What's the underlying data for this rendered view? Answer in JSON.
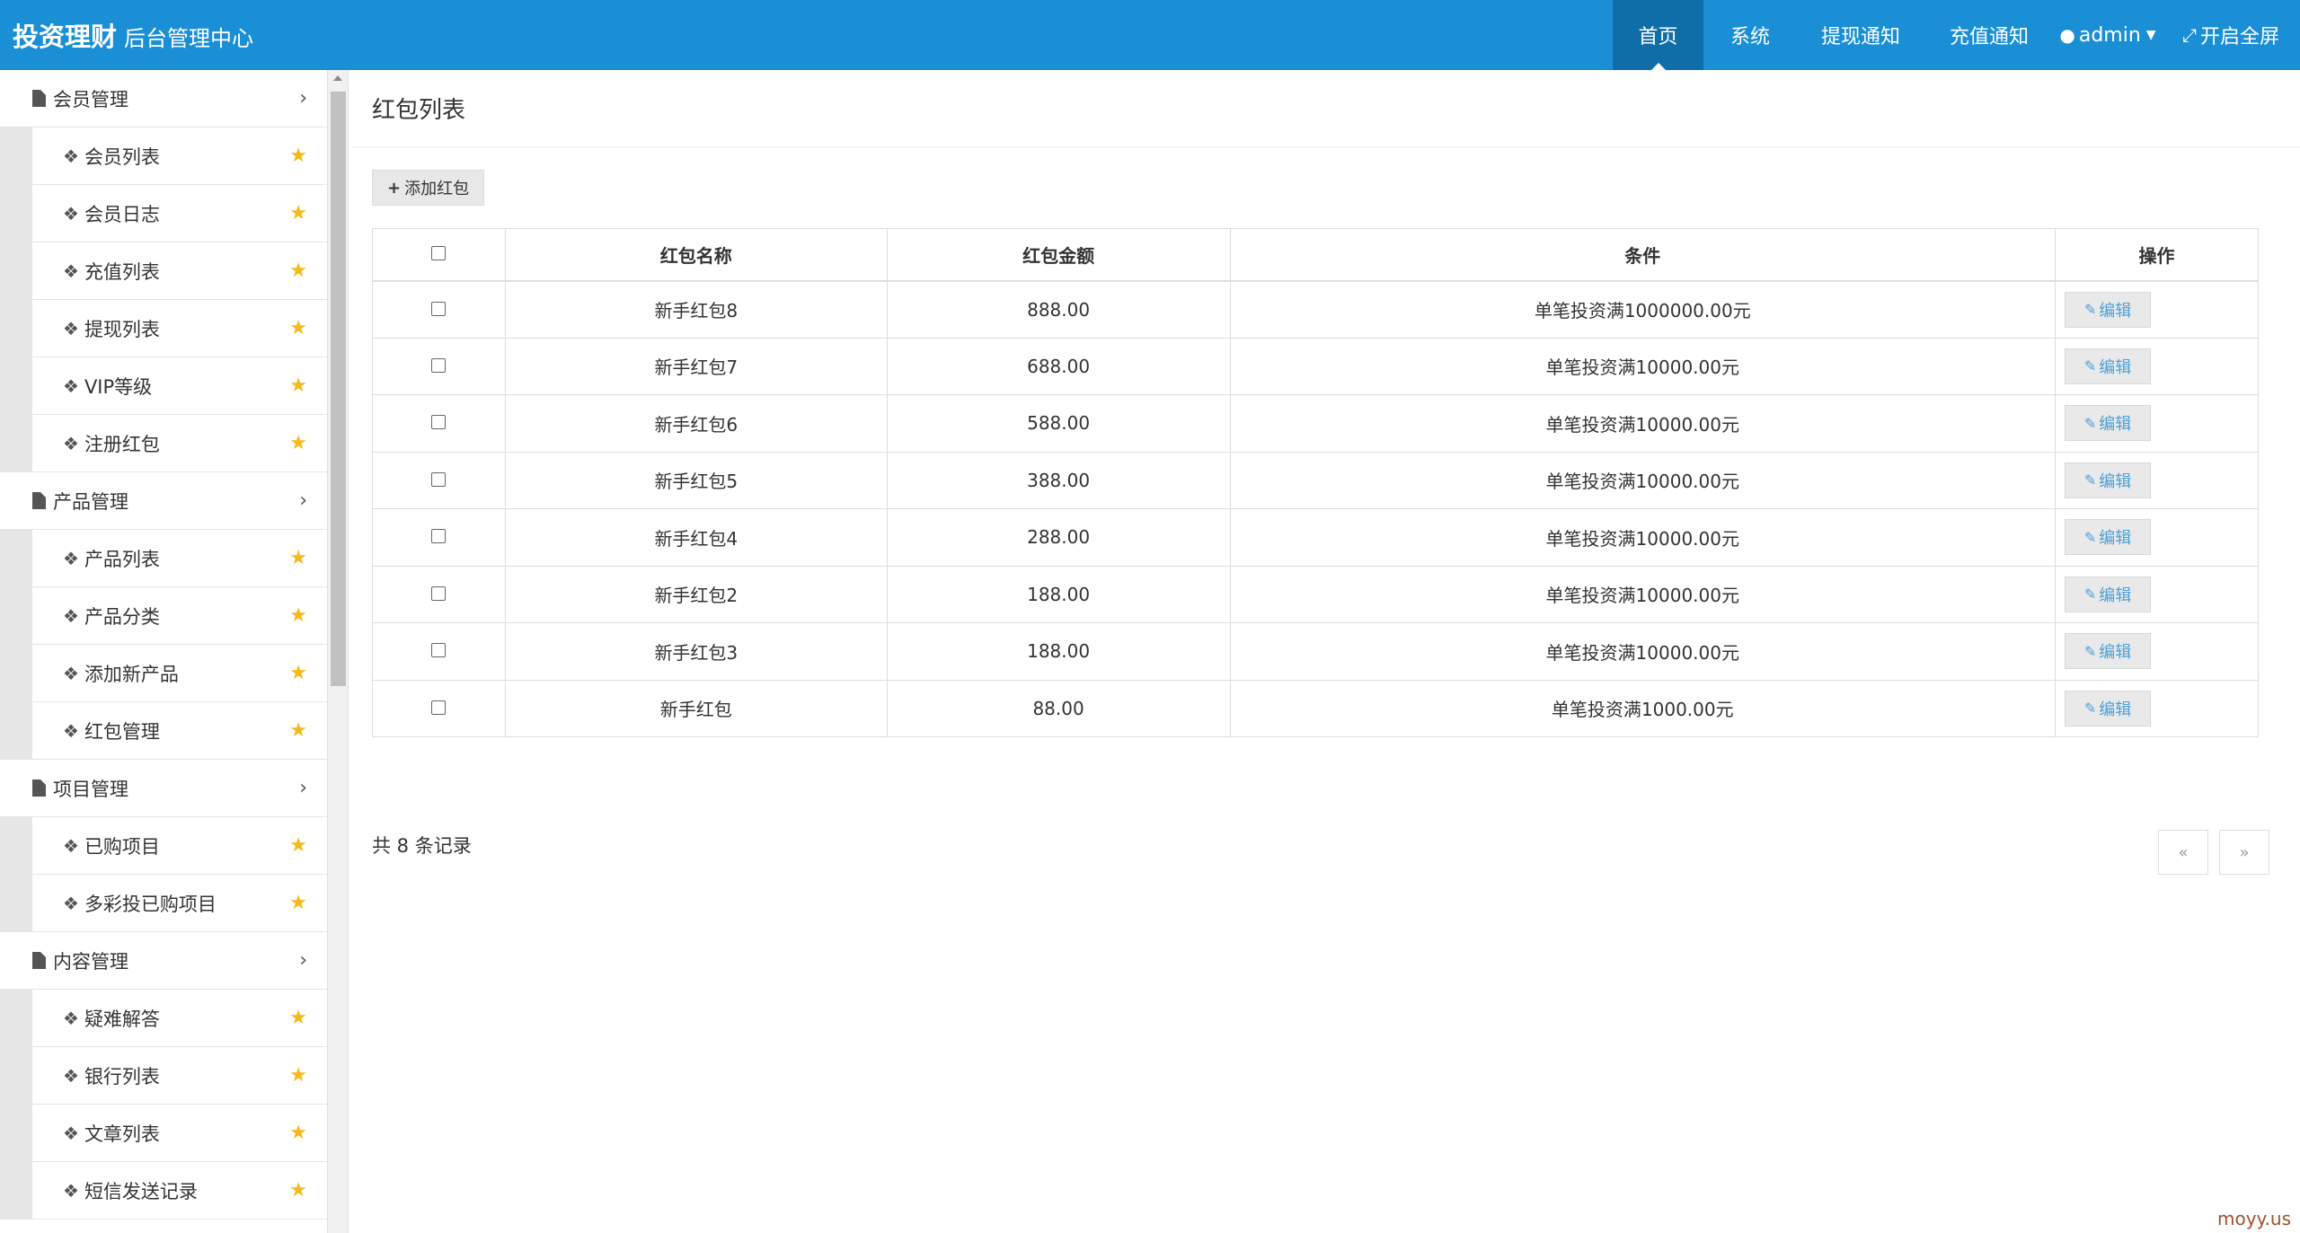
{
  "header": {
    "brand": "投资理财",
    "subtitle": "后台管理中心",
    "nav": [
      {
        "label": "首页",
        "active": true
      },
      {
        "label": "系统"
      },
      {
        "label": "提现通知"
      },
      {
        "label": "充值通知"
      },
      {
        "label": "admin",
        "icon": "user-icon",
        "caret": "caret-down-icon"
      },
      {
        "label": "开启全屏",
        "icon": "fullscreen-icon"
      }
    ]
  },
  "sidebar": {
    "groups": [
      {
        "label": "会员管理",
        "items": [
          "会员列表",
          "会员日志",
          "充值列表",
          "提现列表",
          "VIP等级",
          "注册红包"
        ]
      },
      {
        "label": "产品管理",
        "items": [
          "产品列表",
          "产品分类",
          "添加新产品",
          "红包管理"
        ]
      },
      {
        "label": "项目管理",
        "items": [
          "已购项目",
          "多彩投已购项目"
        ]
      },
      {
        "label": "内容管理",
        "items": [
          "疑难解答",
          "银行列表",
          "文章列表",
          "短信发送记录"
        ]
      }
    ]
  },
  "main": {
    "title": "红包列表",
    "add_button": "添加红包",
    "table": {
      "headers": [
        "红包名称",
        "红包金额",
        "条件",
        "操作"
      ],
      "rows": [
        {
          "name": "新手红包8",
          "amount": "888.00",
          "condition": "单笔投资满1000000.00元",
          "action": "编辑"
        },
        {
          "name": "新手红包7",
          "amount": "688.00",
          "condition": "单笔投资满10000.00元",
          "action": "编辑"
        },
        {
          "name": "新手红包6",
          "amount": "588.00",
          "condition": "单笔投资满10000.00元",
          "action": "编辑"
        },
        {
          "name": "新手红包5",
          "amount": "388.00",
          "condition": "单笔投资满10000.00元",
          "action": "编辑"
        },
        {
          "name": "新手红包4",
          "amount": "288.00",
          "condition": "单笔投资满10000.00元",
          "action": "编辑"
        },
        {
          "name": "新手红包2",
          "amount": "188.00",
          "condition": "单笔投资满10000.00元",
          "action": "编辑"
        },
        {
          "name": "新手红包3",
          "amount": "188.00",
          "condition": "单笔投资满10000.00元",
          "action": "编辑"
        },
        {
          "name": "新手红包",
          "amount": "88.00",
          "condition": "单笔投资满1000.00元",
          "action": "编辑"
        }
      ]
    },
    "total": "共 8 条记录",
    "pager": {
      "prev": "«",
      "next": "»"
    }
  },
  "watermark": "moyy.us",
  "colors": {
    "topbar": "#1a8fd5",
    "topbar_active": "#0f6ea8",
    "star": "#f5b91a",
    "link": "#4aa0d8"
  }
}
